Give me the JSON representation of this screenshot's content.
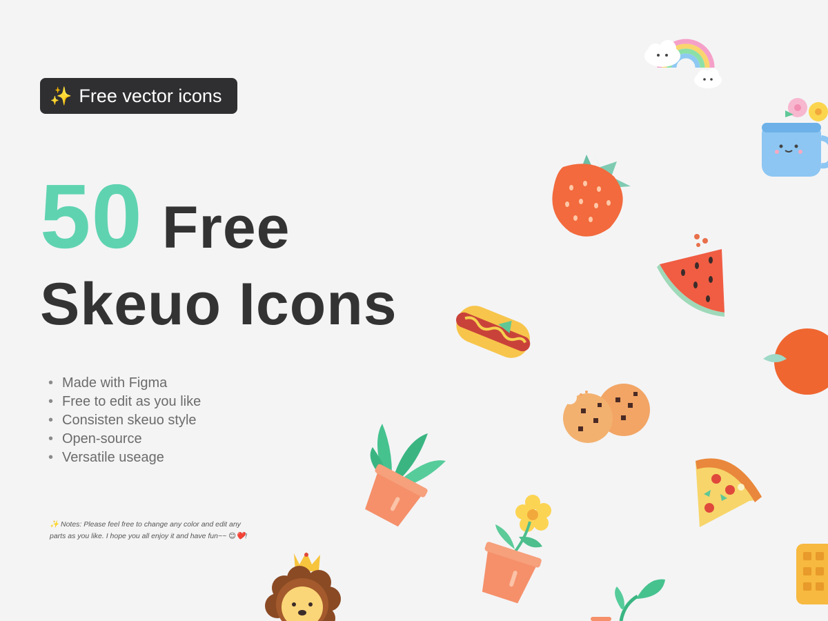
{
  "badge": {
    "sparkle": "✨",
    "text": "Free vector icons"
  },
  "headline": {
    "number": "50",
    "word": "Free",
    "line2": "Skeuo Icons"
  },
  "features": [
    "Made with Figma",
    "Free to edit as you like",
    "Consisten skeuo style",
    "Open-source",
    "Versatile useage"
  ],
  "notes": {
    "sparkle": "✨",
    "text": "Notes: Please feel free to change any color and edit any parts as you like. I hope you all enjoy it and have fun~~ 😊❤️!"
  },
  "colors": {
    "accent": "#5fd3b0",
    "dark": "#333333",
    "badge_bg": "#2f2f31",
    "background": "#f4f4f5"
  },
  "icons": [
    "rainbow-icon",
    "flower-mug-icon",
    "strawberry-icon",
    "watermelon-icon",
    "hotdog-icon",
    "orange-icon",
    "cookies-icon",
    "potted-plant-icon",
    "pizza-icon",
    "flower-pot-icon",
    "waffle-icon",
    "lion-icon",
    "sprout-icon"
  ]
}
